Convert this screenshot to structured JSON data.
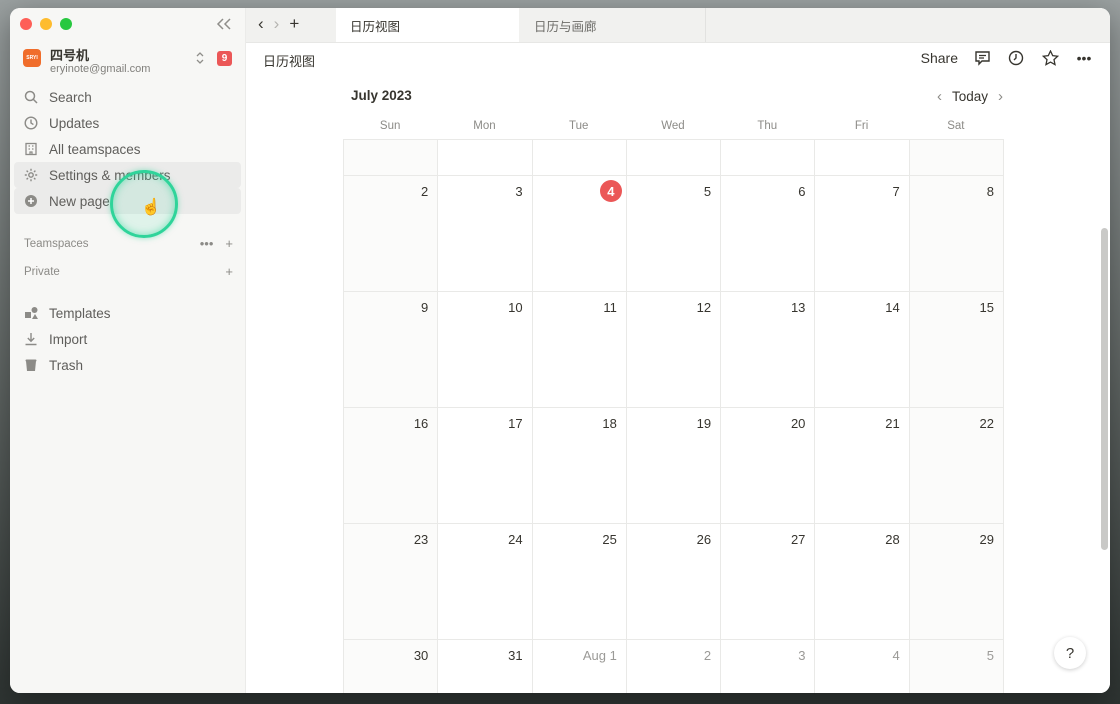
{
  "sidebar": {
    "workspace": {
      "logo": "SRYI",
      "name": "四号机",
      "email": "eryinote@gmail.com",
      "badge": "9"
    },
    "nav": [
      {
        "label": "Search",
        "icon": "search-icon"
      },
      {
        "label": "Updates",
        "icon": "clock-icon"
      },
      {
        "label": "All teamspaces",
        "icon": "building-icon"
      },
      {
        "label": "Settings & members",
        "icon": "gear-icon"
      },
      {
        "label": "New page",
        "icon": "plus-circle-icon"
      }
    ],
    "teamspaces_label": "Teamspaces",
    "private_label": "Private",
    "bottom": [
      {
        "label": "Templates",
        "icon": "shapes-icon"
      },
      {
        "label": "Import",
        "icon": "download-icon"
      },
      {
        "label": "Trash",
        "icon": "trash-icon"
      }
    ]
  },
  "tabs": [
    {
      "label": "日历视图",
      "active": true
    },
    {
      "label": "日历与画廊",
      "active": false
    }
  ],
  "topbar": {
    "breadcrumb": "日历视图",
    "share_label": "Share"
  },
  "calendar": {
    "month": "July 2023",
    "today_label": "Today",
    "weekdays": [
      "Sun",
      "Mon",
      "Tue",
      "Wed",
      "Thu",
      "Fri",
      "Sat"
    ],
    "weeks": [
      [
        "",
        "",
        "",
        "",
        "",
        "",
        ""
      ],
      [
        "2",
        "3",
        "4",
        "5",
        "6",
        "7",
        "8"
      ],
      [
        "9",
        "10",
        "11",
        "12",
        "13",
        "14",
        "15"
      ],
      [
        "16",
        "17",
        "18",
        "19",
        "20",
        "21",
        "22"
      ],
      [
        "23",
        "24",
        "25",
        "26",
        "27",
        "28",
        "29"
      ],
      [
        "30",
        "31",
        "Aug 1",
        "2",
        "3",
        "4",
        "5"
      ]
    ],
    "today": "4",
    "other_month_days": [
      "Aug 1",
      "2",
      "3",
      "4",
      "5"
    ]
  },
  "help_label": "?",
  "colors": {
    "accent": "#eb5757",
    "cursor_ring": "#2fd49a",
    "sidebar_bg": "#f7f7f5"
  }
}
